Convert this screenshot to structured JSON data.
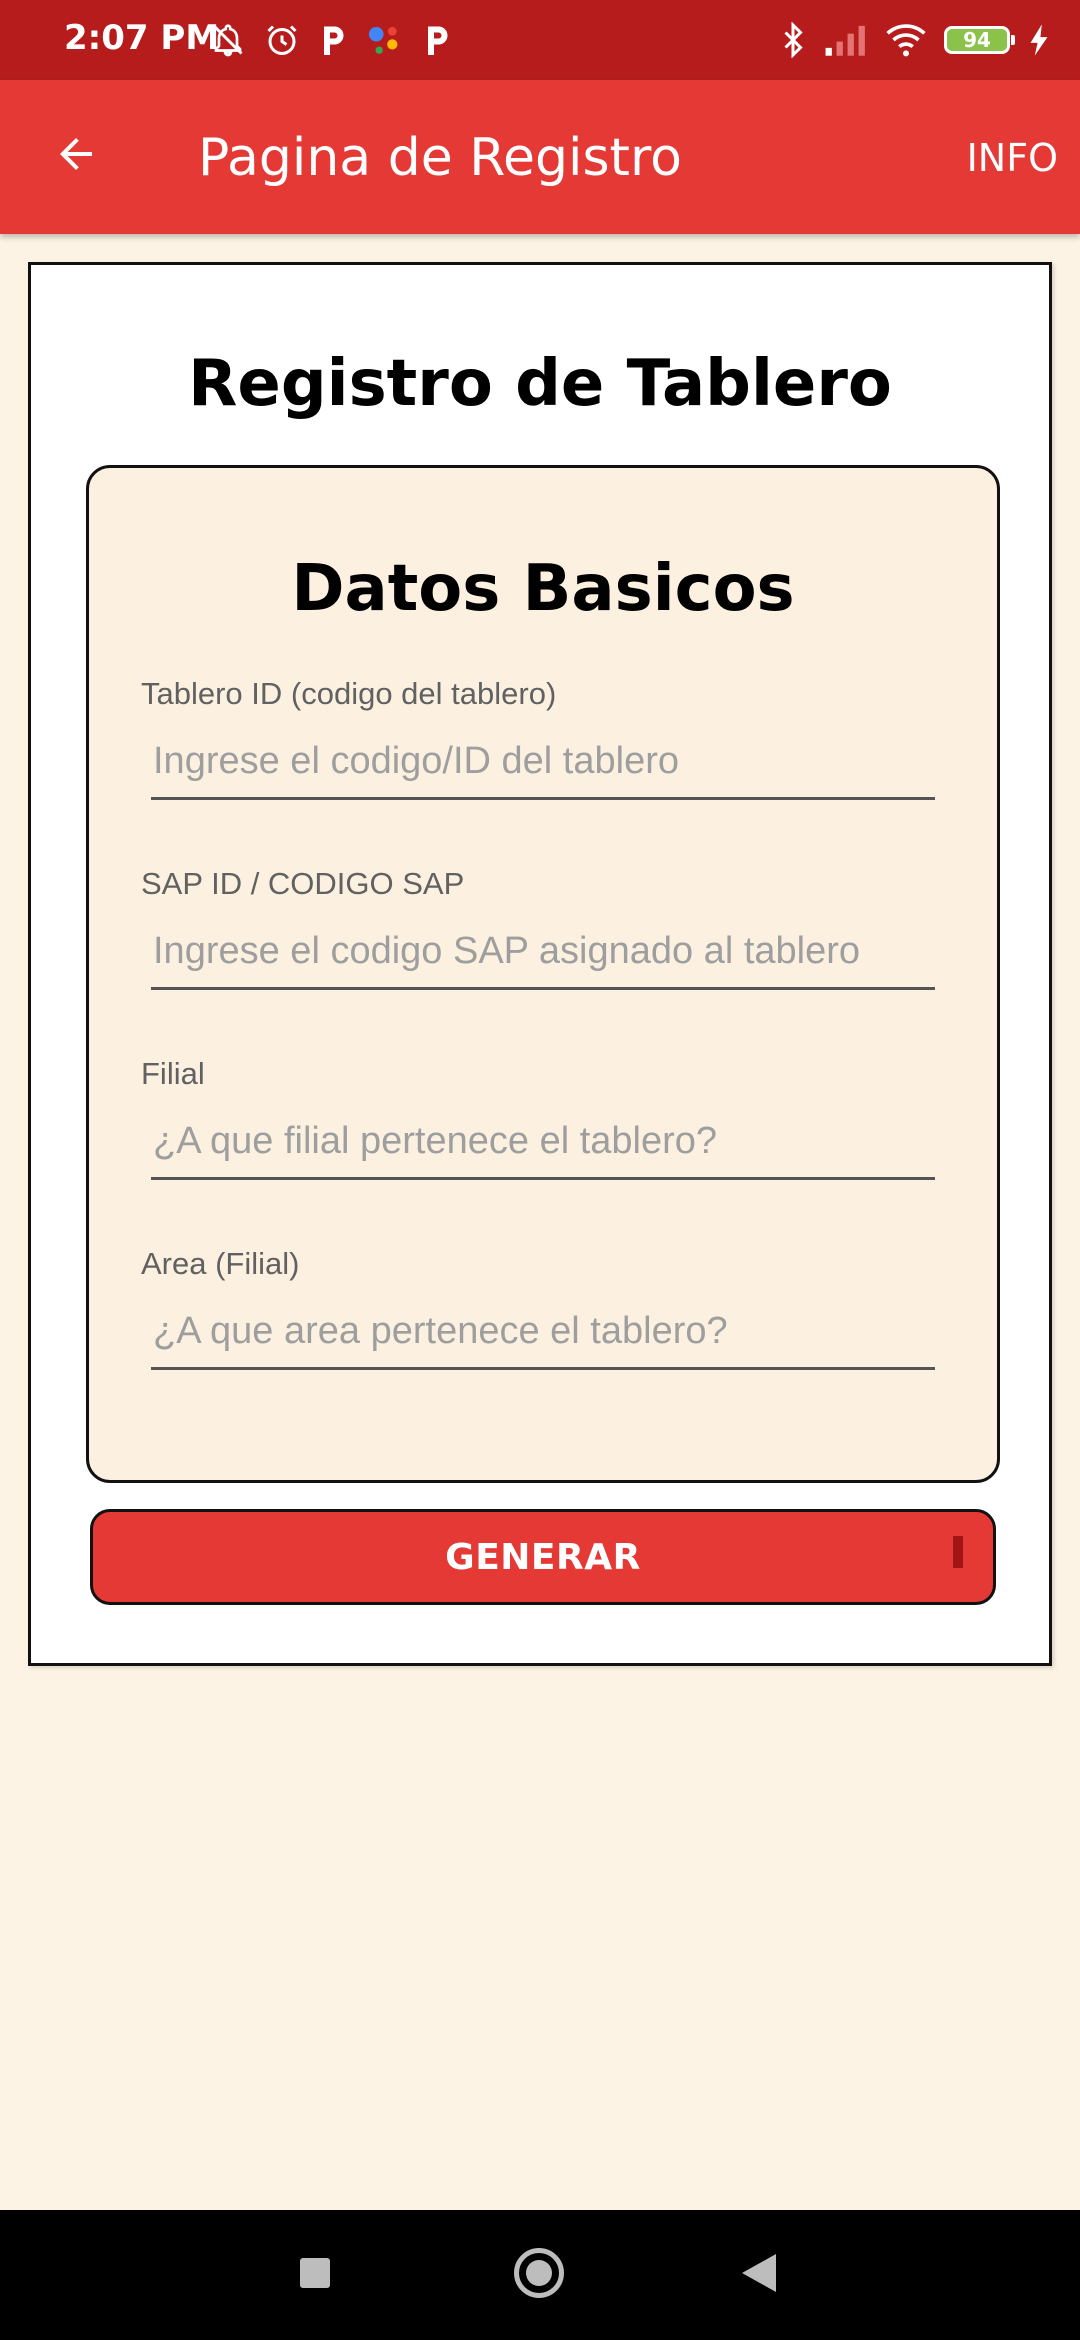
{
  "status_bar": {
    "time": "2:07 PM",
    "battery": "94",
    "icons_left": [
      "notifications-off-icon",
      "alarm-icon",
      "p-app-icon",
      "assistant-icon",
      "p-app-icon"
    ],
    "icons_right": [
      "bluetooth-icon",
      "signal-icon",
      "wifi-icon",
      "battery-icon",
      "charging-icon"
    ]
  },
  "app_bar": {
    "title": "Pagina de Registro",
    "info_label": "INFO",
    "back_icon": "arrow-back-icon"
  },
  "form": {
    "heading": "Registro de Tablero",
    "section_title": "Datos Basicos",
    "fields": [
      {
        "label": "Tablero ID (codigo del tablero)",
        "placeholder": "Ingrese el codigo/ID del tablero",
        "value": ""
      },
      {
        "label": "SAP ID / CODIGO SAP",
        "placeholder": "Ingrese el codigo SAP asignado al tablero",
        "value": ""
      },
      {
        "label": "Filial",
        "placeholder": "¿A que filial pertenece el tablero?",
        "value": ""
      },
      {
        "label": "Area (Filial)",
        "placeholder": "¿A que area pertenece el tablero?",
        "value": ""
      }
    ],
    "submit_label": "GENERAR"
  },
  "colors": {
    "status_bar": "#b71c1c",
    "app_bar": "#e53935",
    "background": "#fcf3e4",
    "inner_card": "#fcf1e1",
    "button": "#e53935"
  }
}
